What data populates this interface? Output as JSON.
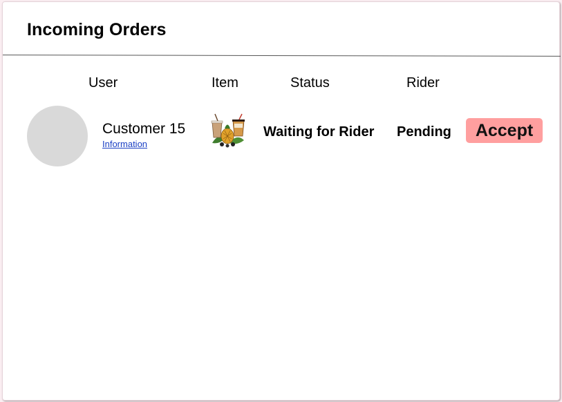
{
  "page": {
    "title": "Incoming Orders"
  },
  "table": {
    "headers": {
      "user": "User",
      "item": "Item",
      "status": "Status",
      "rider": "Rider"
    },
    "rows": [
      {
        "customer_name": "Customer 15",
        "info_link": "Information",
        "item_image": "milk-tea-drinks-image",
        "status": "Waiting for Rider",
        "rider": "Pending",
        "action_label": "Accept"
      }
    ]
  },
  "colors": {
    "accent_button": "#ff9f9f",
    "link": "#1a3fc4",
    "avatar": "#d9d9d9",
    "background": "#fbeef2"
  }
}
